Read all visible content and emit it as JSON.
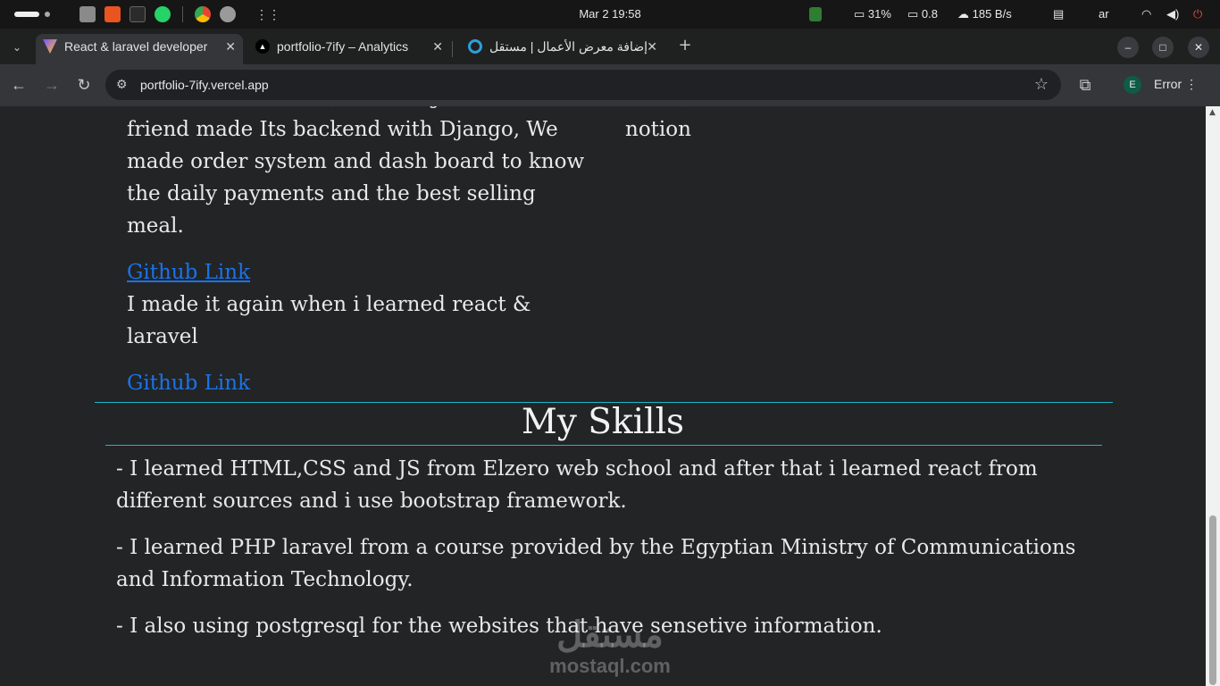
{
  "os": {
    "clock": "Mar 2  19:58",
    "battery": "31%",
    "display": "0.8",
    "network_speed": "185 B/s",
    "language": "ar"
  },
  "tabs": [
    {
      "title": "React & laravel developer",
      "active": true
    },
    {
      "title": "portfolio-7ify – Analytics",
      "active": false
    },
    {
      "title": "إضافة معرض الأعمال | مستقل",
      "active": false
    }
  ],
  "toolbar": {
    "url": "portfolio-7ify.vercel.app",
    "profile_initial": "E",
    "error_label": "Error"
  },
  "page": {
    "left_col": {
      "partial_line": "made it with HTML,CSS and JS and i have a",
      "desc1": "friend made Its backend with Django, We made order system and dash board to know the daily payments and the best selling meal.",
      "link1": "Github Link",
      "desc2": "I made it again when i learned react & laravel",
      "link2": "Github Link"
    },
    "right_col": {
      "partial_line": "CRM , it will be like a miniature version of",
      "word": "notion"
    },
    "skills": {
      "title": "My Skills",
      "items": [
        "- I learned HTML,CSS and JS from Elzero web school and after that i learned react from different sources and i use bootstrap framework.",
        "- I learned PHP laravel from a course provided by the Egyptian Ministry of Communications and Information Technology.",
        "- I also using postgresql for the websites that have sensetive information."
      ]
    },
    "watermark": {
      "arabic": "مستقل",
      "latin": "mostaql.com"
    }
  },
  "colors": {
    "accent_line": "#18b7c9",
    "link": "#1a73e8",
    "page_bg": "#222426"
  }
}
